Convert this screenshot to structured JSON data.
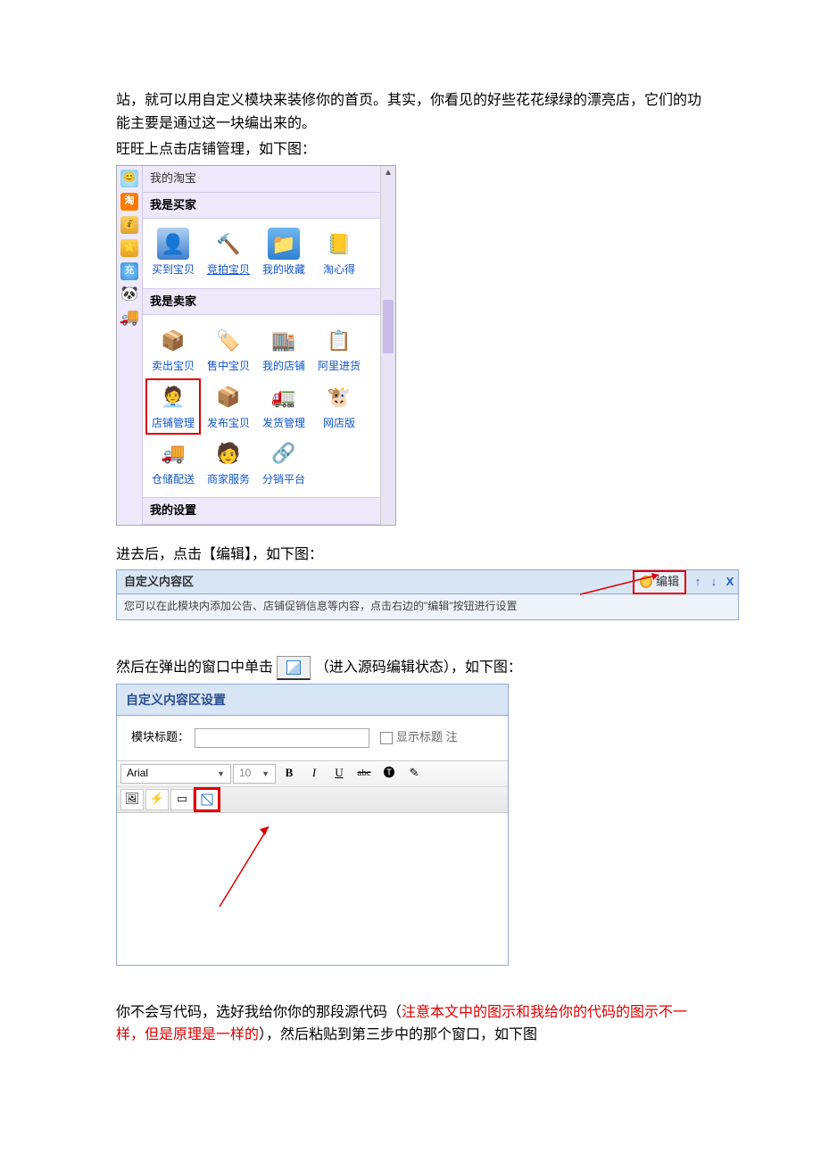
{
  "para1": "站，就可以用自定义模块来装修你的首页。其实，你看见的好些花花绿绿的漂亮店，它们的功能主要是通过这一块编出来的。",
  "para2": "旺旺上点击店铺管理，如下图：",
  "taobao": {
    "tab": "我的淘宝",
    "buyer_header": "我是买家",
    "buyer_items": [
      "买到宝贝",
      "竞拍宝贝",
      "我的收藏",
      "淘心得"
    ],
    "seller_header": "我是卖家",
    "seller_row1": [
      "卖出宝贝",
      "售中宝贝",
      "我的店铺",
      "阿里进货"
    ],
    "seller_row2": [
      "店铺管理",
      "发布宝贝",
      "发货管理",
      "网店版"
    ],
    "seller_row3": [
      "仓储配送",
      "商家服务",
      "分销平台"
    ],
    "settings_header": "我的设置"
  },
  "para3": "进去后，点击【编辑】，如下图：",
  "editbar": {
    "title": "自定义内容区",
    "btn": "编辑",
    "desc": "您可以在此模块内添加公告、店铺促销信息等内容，点击右边的\"编辑\"按钮进行设置",
    "x": "X"
  },
  "para4a": "然后在弹出的窗口中单击",
  "para4b": "（进入源码编辑状态），如下图：",
  "settings": {
    "title": "自定义内容区设置",
    "label": "模块标题：",
    "show_label": "显示标题 注",
    "font": "Arial",
    "size": "10",
    "bold": "B",
    "italic": "I",
    "underline": "U",
    "strike": "abc"
  },
  "para5a": "你不会写代码，选好我给你你的那段源代码（",
  "para5b": "注意本文中的图示和我给你的代码的图示不一样，但是原理是一样的",
  "para5c": "），然后粘贴到第三步中的那个窗口，如下图"
}
